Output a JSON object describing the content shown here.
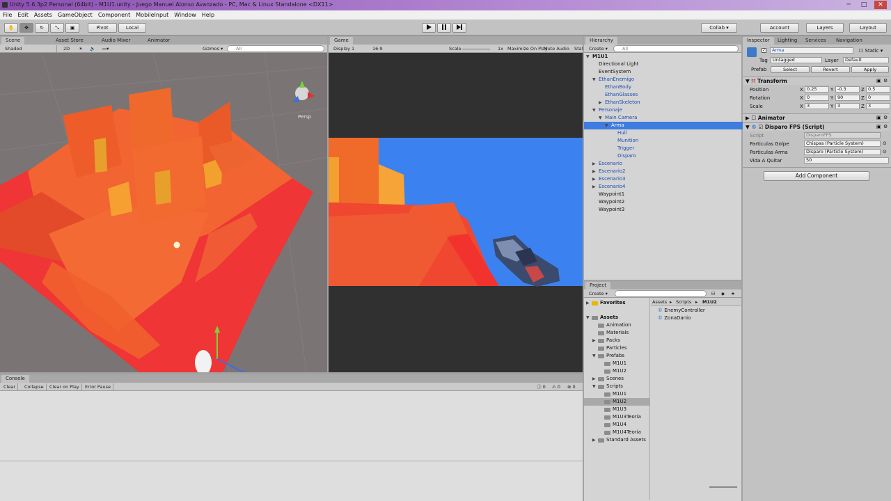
{
  "window": {
    "title": "Unity 5.6.3p2 Personal (64bit) - M1U1.unity - Juego Manuel Alonso Avanzado - PC, Mac & Linux Standalone <DX11>",
    "min": "─",
    "max": "□",
    "close": "✕"
  },
  "menu": [
    "File",
    "Edit",
    "Assets",
    "GameObject",
    "Component",
    "MobileInput",
    "Window",
    "Help"
  ],
  "toolbar": {
    "pivot": "Pivot",
    "local": "Local",
    "collab": "Collab ▾",
    "account": "Account",
    "layers": "Layers",
    "layout": "Layout"
  },
  "scene": {
    "tabs": [
      "Scene",
      "Asset Store",
      "Audio Mixer",
      "Animator"
    ],
    "shading": "Shaded",
    "mode2d": "2D",
    "gizmos": "Gizmos ▾",
    "search": "All",
    "persp": "Persp"
  },
  "game": {
    "tab": "Game",
    "display": "Display 1",
    "aspect": "16:9",
    "scale_label": "Scale",
    "scale_value": "1x",
    "maximize": "Maximize On Play",
    "mute": "Mute Audio",
    "stats": "Stats"
  },
  "console": {
    "tab": "Console",
    "clear": "Clear",
    "collapse": "Collapse",
    "clear_on_play": "Clear on Play",
    "error_pause": "Error Pause",
    "count_info": "0",
    "count_warn": "0",
    "count_err": "0"
  },
  "hierarchy": {
    "tab": "Hierarchy",
    "create": "Create ▾",
    "search": "All",
    "items": [
      {
        "label": "M1U1",
        "indent": 0,
        "arrow": "▼",
        "style": "scene"
      },
      {
        "label": "Directional Light",
        "indent": 1,
        "arrow": "",
        "style": ""
      },
      {
        "label": "EventSystem",
        "indent": 1,
        "arrow": "",
        "style": ""
      },
      {
        "label": "EthanEnemigo",
        "indent": 1,
        "arrow": "▼",
        "style": "blue"
      },
      {
        "label": "EthanBody",
        "indent": 2,
        "arrow": "",
        "style": "blue"
      },
      {
        "label": "EthanGlasses",
        "indent": 2,
        "arrow": "",
        "style": "blue"
      },
      {
        "label": "EthanSkeleton",
        "indent": 2,
        "arrow": "▶",
        "style": "blue"
      },
      {
        "label": "Personaje",
        "indent": 1,
        "arrow": "▼",
        "style": "blue"
      },
      {
        "label": "Main Camera",
        "indent": 2,
        "arrow": "▼",
        "style": "blue"
      },
      {
        "label": "Arma",
        "indent": 3,
        "arrow": "▼",
        "style": "sel"
      },
      {
        "label": "Hull",
        "indent": 4,
        "arrow": "",
        "style": "blue"
      },
      {
        "label": "Munition",
        "indent": 4,
        "arrow": "",
        "style": "blue"
      },
      {
        "label": "Trigger",
        "indent": 4,
        "arrow": "",
        "style": "blue"
      },
      {
        "label": "Disparo",
        "indent": 4,
        "arrow": "",
        "style": "blue"
      },
      {
        "label": "Escenario",
        "indent": 1,
        "arrow": "▶",
        "style": "blue"
      },
      {
        "label": "Escenario2",
        "indent": 1,
        "arrow": "▶",
        "style": "blue"
      },
      {
        "label": "Escenario3",
        "indent": 1,
        "arrow": "▶",
        "style": "blue"
      },
      {
        "label": "Escenario4",
        "indent": 1,
        "arrow": "▶",
        "style": "blue"
      },
      {
        "label": "Waypoint1",
        "indent": 1,
        "arrow": "",
        "style": ""
      },
      {
        "label": "Waypoint2",
        "indent": 1,
        "arrow": "",
        "style": ""
      },
      {
        "label": "Waypoint3",
        "indent": 1,
        "arrow": "",
        "style": ""
      }
    ]
  },
  "project": {
    "tab": "Project",
    "create": "Create ▾",
    "tree": [
      {
        "label": "Favorites",
        "indent": 0,
        "arrow": "▶",
        "bold": true,
        "selected": false
      },
      {
        "label": "Assets",
        "indent": 0,
        "arrow": "▼",
        "bold": true,
        "selected": false
      },
      {
        "label": "Animation",
        "indent": 1,
        "arrow": "",
        "bold": false,
        "selected": false
      },
      {
        "label": "Materials",
        "indent": 1,
        "arrow": "",
        "bold": false,
        "selected": false
      },
      {
        "label": "Packs",
        "indent": 1,
        "arrow": "▶",
        "bold": false,
        "selected": false
      },
      {
        "label": "Particles",
        "indent": 1,
        "arrow": "",
        "bold": false,
        "selected": false
      },
      {
        "label": "Prefabs",
        "indent": 1,
        "arrow": "▼",
        "bold": false,
        "selected": false
      },
      {
        "label": "M1U1",
        "indent": 2,
        "arrow": "",
        "bold": false,
        "selected": false
      },
      {
        "label": "M1U2",
        "indent": 2,
        "arrow": "",
        "bold": false,
        "selected": false
      },
      {
        "label": "Scenes",
        "indent": 1,
        "arrow": "▶",
        "bold": false,
        "selected": false
      },
      {
        "label": "Scripts",
        "indent": 1,
        "arrow": "▼",
        "bold": false,
        "selected": false
      },
      {
        "label": "M1U1",
        "indent": 2,
        "arrow": "",
        "bold": false,
        "selected": false
      },
      {
        "label": "M1U2",
        "indent": 2,
        "arrow": "",
        "bold": false,
        "selected": true
      },
      {
        "label": "M1U3",
        "indent": 2,
        "arrow": "",
        "bold": false,
        "selected": false
      },
      {
        "label": "M1U3Teoria",
        "indent": 2,
        "arrow": "",
        "bold": false,
        "selected": false
      },
      {
        "label": "M1U4",
        "indent": 2,
        "arrow": "",
        "bold": false,
        "selected": false
      },
      {
        "label": "M1U4Teoria",
        "indent": 2,
        "arrow": "",
        "bold": false,
        "selected": false
      },
      {
        "label": "Standard Assets",
        "indent": 1,
        "arrow": "▶",
        "bold": false,
        "selected": false
      }
    ],
    "breadcrumb": [
      "Assets",
      "Scripts",
      "M1U2"
    ],
    "files": [
      "EnemyController",
      "ZonaDanio"
    ]
  },
  "inspector": {
    "tabs": [
      "Inspector",
      "Lighting",
      "Services",
      "Navigation"
    ],
    "name": "Arma",
    "static": "Static ▾",
    "tag_label": "Tag",
    "tag": "Untagged",
    "layer_label": "Layer",
    "layer": "Default",
    "prefab_label": "Prefab",
    "select": "Select",
    "revert": "Revert",
    "apply": "Apply",
    "transform": {
      "title": "Transform",
      "rows": [
        {
          "label": "Position",
          "x": "0.25",
          "y": "-0.3",
          "z": "0.5"
        },
        {
          "label": "Rotation",
          "x": "0",
          "y": "90",
          "z": "0"
        },
        {
          "label": "Scale",
          "x": "3",
          "y": "3",
          "z": "3"
        }
      ]
    },
    "animator": {
      "title": "Animator"
    },
    "script": {
      "title": "Disparo FPS (Script)",
      "fields": [
        {
          "label": "Script",
          "value": "DisparoFPS"
        },
        {
          "label": "Particulas Golpe",
          "value": "Chispas (Particle System)"
        },
        {
          "label": "Particulas Arma",
          "value": "Disparo (Particle System)"
        },
        {
          "label": "Vida A Quitar",
          "value": "50"
        }
      ]
    },
    "add_component": "Add Component"
  },
  "colors": {
    "selection": "#3e7ce0",
    "prefab_text": "#1d4eb3",
    "sky": "#3b82f0",
    "orange": "#f06a2a",
    "red": "#ef3030"
  }
}
